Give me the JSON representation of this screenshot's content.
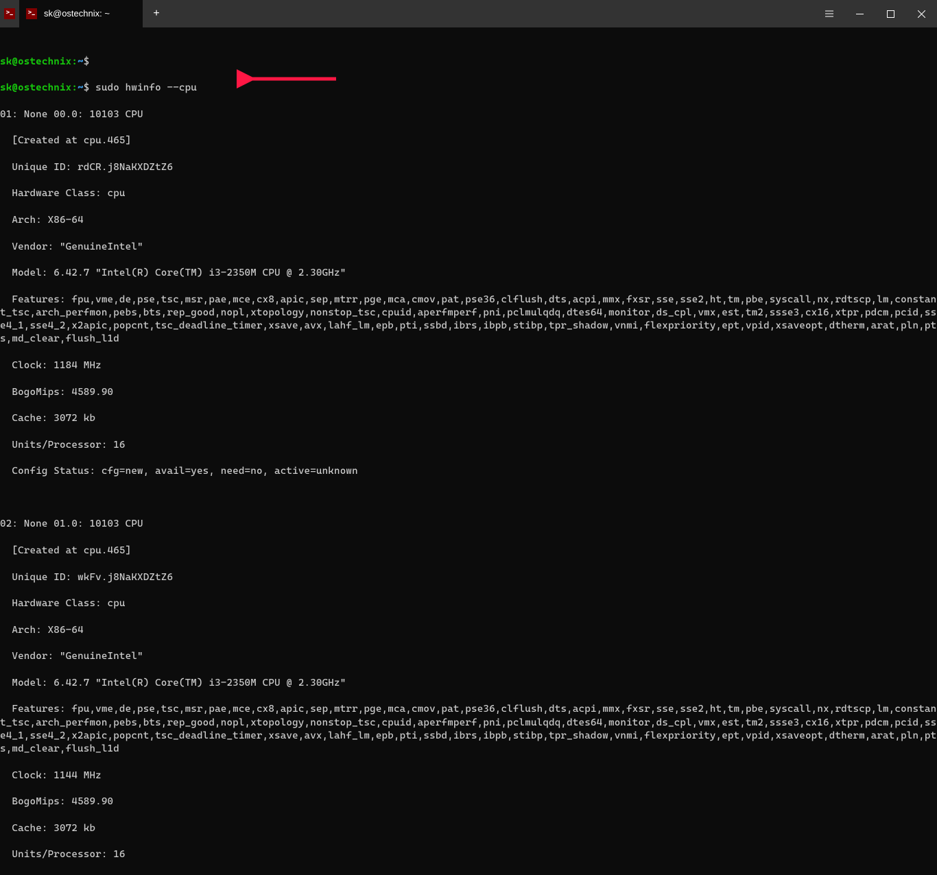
{
  "titlebar": {
    "tab_title": "sk@ostechnix: ~",
    "tab_icon_glyph": ">_",
    "new_tab_label": "+"
  },
  "prompt": {
    "user_host": "sk@ostechnix",
    "path": "~",
    "sep": ":",
    "dollar": "$"
  },
  "commands": {
    "blank": "",
    "cmd1": "sudo hwinfo --cpu"
  },
  "cpu1": {
    "header": "01: None 00.0: 10103 CPU",
    "created": "  [Created at cpu.465]",
    "unique": "  Unique ID: rdCR.j8NaKXDZtZ6",
    "hwclass": "  Hardware Class: cpu",
    "arch": "  Arch: X86-64",
    "vendor": "  Vendor: \"GenuineIntel\"",
    "model": "  Model: 6.42.7 \"Intel(R) Core(TM) i3-2350M CPU @ 2.30GHz\"",
    "features": "  Features: fpu,vme,de,pse,tsc,msr,pae,mce,cx8,apic,sep,mtrr,pge,mca,cmov,pat,pse36,clflush,dts,acpi,mmx,fxsr,sse,sse2,ht,tm,pbe,syscall,nx,rdtscp,lm,constant_tsc,arch_perfmon,pebs,bts,rep_good,nopl,xtopology,nonstop_tsc,cpuid,aperfmperf,pni,pclmulqdq,dtes64,monitor,ds_cpl,vmx,est,tm2,ssse3,cx16,xtpr,pdcm,pcid,sse4_1,sse4_2,x2apic,popcnt,tsc_deadline_timer,xsave,avx,lahf_lm,epb,pti,ssbd,ibrs,ibpb,stibp,tpr_shadow,vnmi,flexpriority,ept,vpid,xsaveopt,dtherm,arat,pln,pts,md_clear,flush_l1d",
    "clock": "  Clock: 1184 MHz",
    "bogomips": "  BogoMips: 4589.90",
    "cache": "  Cache: 3072 kb",
    "units": "  Units/Processor: 16",
    "config": "  Config Status: cfg=new, avail=yes, need=no, active=unknown"
  },
  "cpu2": {
    "header": "02: None 01.0: 10103 CPU",
    "created": "  [Created at cpu.465]",
    "unique": "  Unique ID: wkFv.j8NaKXDZtZ6",
    "hwclass": "  Hardware Class: cpu",
    "arch": "  Arch: X86-64",
    "vendor": "  Vendor: \"GenuineIntel\"",
    "model": "  Model: 6.42.7 \"Intel(R) Core(TM) i3-2350M CPU @ 2.30GHz\"",
    "features": "  Features: fpu,vme,de,pse,tsc,msr,pae,mce,cx8,apic,sep,mtrr,pge,mca,cmov,pat,pse36,clflush,dts,acpi,mmx,fxsr,sse,sse2,ht,tm,pbe,syscall,nx,rdtscp,lm,constant_tsc,arch_perfmon,pebs,bts,rep_good,nopl,xtopology,nonstop_tsc,cpuid,aperfmperf,pni,pclmulqdq,dtes64,monitor,ds_cpl,vmx,est,tm2,ssse3,cx16,xtpr,pdcm,pcid,sse4_1,sse4_2,x2apic,popcnt,tsc_deadline_timer,xsave,avx,lahf_lm,epb,pti,ssbd,ibrs,ibpb,stibp,tpr_shadow,vnmi,flexpriority,ept,vpid,xsaveopt,dtherm,arat,pln,pts,md_clear,flush_l1d",
    "clock": "  Clock: 1144 MHz",
    "bogomips": "  BogoMips: 4589.90",
    "cache": "  Cache: 3072 kb",
    "units": "  Units/Processor: 16"
  }
}
